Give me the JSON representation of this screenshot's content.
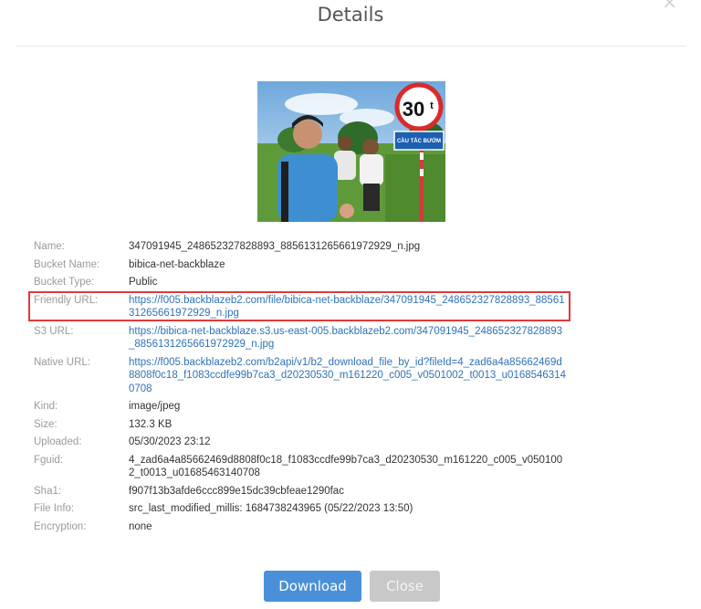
{
  "dialog": {
    "title": "Details",
    "close_icon": "×"
  },
  "details": [
    {
      "label": "Name:",
      "value": "347091945_248652327828893_8856131265661972929_n.jpg",
      "link": false
    },
    {
      "label": "Bucket Name:",
      "value": "bibica-net-backblaze",
      "link": false
    },
    {
      "label": "Bucket Type:",
      "value": "Public",
      "link": false
    },
    {
      "label": "Friendly URL:",
      "value": "https://f005.backblazeb2.com/file/bibica-net-backblaze/347091945_248652327828893_8856131265661972929_n.jpg",
      "link": true
    },
    {
      "label": "S3 URL:",
      "value": "https://bibica-net-backblaze.s3.us-east-005.backblazeb2.com/347091945_248652327828893_8856131265661972929_n.jpg",
      "link": true
    },
    {
      "label": "Native URL:",
      "value": "https://f005.backblazeb2.com/b2api/v1/b2_download_file_by_id?fileId=4_zad6a4a85662469d8808f0c18_f1083ccdfe99b7ca3_d20230530_m161220_c005_v0501002_t0013_u01685463140708",
      "link": true
    },
    {
      "label": "Kind:",
      "value": "image/jpeg",
      "link": false
    },
    {
      "label": "Size:",
      "value": "132.3 KB",
      "link": false
    },
    {
      "label": "Uploaded:",
      "value": "05/30/2023 23:12",
      "link": false
    },
    {
      "label": "Fguid:",
      "value": "4_zad6a4a85662469d8808f0c18_f1083ccdfe99b7ca3_d20230530_m161220_c005_v0501002_t0013_u01685463140708",
      "link": false
    },
    {
      "label": "Sha1:",
      "value": "f907f13b3afde6ccc899e15dc39cbfeae1290fac",
      "link": false
    },
    {
      "label": "File Info:",
      "value": "src_last_modified_millis: 1684738243965  (05/22/2023 13:50)",
      "link": false
    },
    {
      "label": "Encryption:",
      "value": "none",
      "link": false
    }
  ],
  "thumbnail": {
    "sign_speed": "30",
    "sign_speed_unit": "t",
    "sign_text": "CẦU TẮC BƯỚM"
  },
  "buttons": {
    "download": "Download",
    "close": "Close"
  },
  "colors": {
    "link": "#2f72b9",
    "download_bg": "#4a90d9",
    "close_bg": "#c8c8c8",
    "highlight": "#e03a3a"
  }
}
